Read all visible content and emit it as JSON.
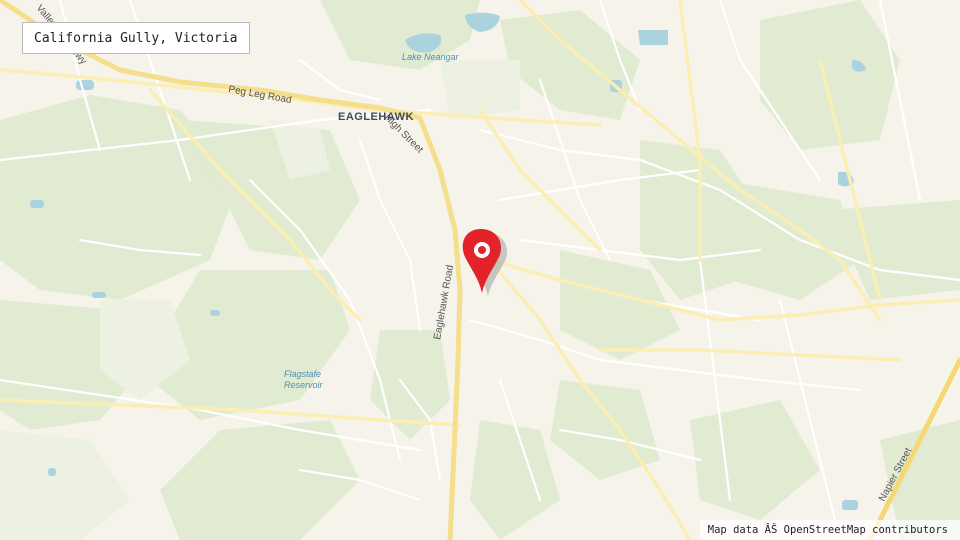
{
  "title": "California Gully, Victoria",
  "attribution": "Map data ÂŠ OpenStreetMap contributors",
  "labels": {
    "suburb": "EAGLEHAWK",
    "water_1": "Lake Neangar",
    "water_2_line1": "Flagstafe",
    "water_2_line2": "Reservoir",
    "road_peg_leg": "Peg Leg Road",
    "road_high": "High Street",
    "road_eaglehawk": "Eaglehawk Road",
    "road_napier": "Napier Street",
    "road_valley_partial": "Valley",
    "road_valley_partial_2": "Hwy"
  },
  "colors": {
    "background": "#f6f3ea",
    "greenspace": "#dfead0",
    "water": "#aad3df",
    "road_minor": "#ffffff",
    "road_major": "#fbeeb4",
    "road_primary": "#f5de8c",
    "marker": "#e2232a",
    "suburb_label": "#3f4a5a",
    "water_label": "#4f8fb0"
  },
  "marker_icon": "map-pin-icon"
}
